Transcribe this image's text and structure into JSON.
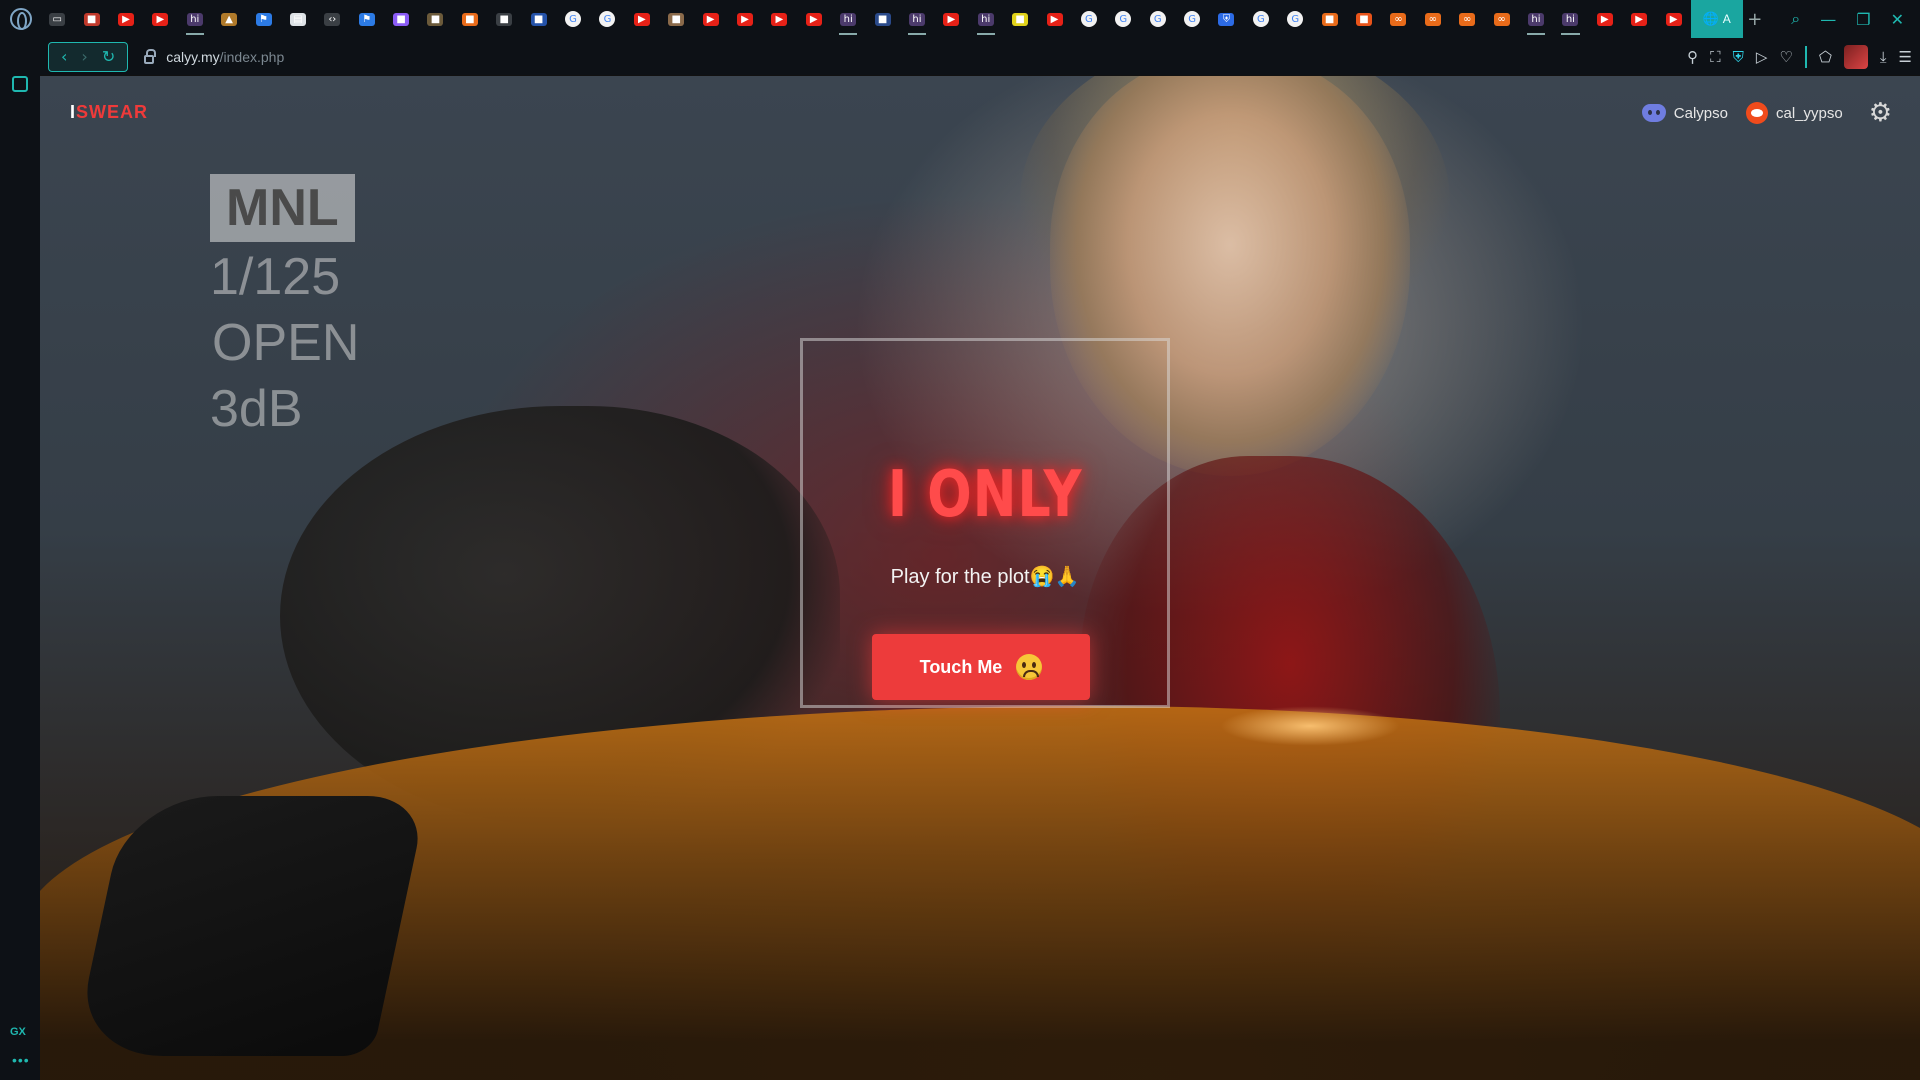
{
  "browser": {
    "tab_favicons": [
      {
        "icon": "video-icon",
        "color": "#3a3f44"
      },
      {
        "icon": "app-icon",
        "color": "#c0392b"
      },
      {
        "icon": "youtube-icon",
        "color": "#e62117"
      },
      {
        "icon": "youtube-icon",
        "color": "#e62117"
      },
      {
        "icon": "hianime-icon",
        "color": "#4b3a6b"
      },
      {
        "icon": "drive-icon",
        "color": "#b07a2a"
      },
      {
        "icon": "flag-icon",
        "color": "#2c7be5"
      },
      {
        "icon": "file-icon",
        "color": "#dde2e6"
      },
      {
        "icon": "code-icon",
        "color": "#3a3f44"
      },
      {
        "icon": "flag-icon",
        "color": "#2c7be5"
      },
      {
        "icon": "app-icon",
        "color": "#8b5cf6"
      },
      {
        "icon": "app-icon",
        "color": "#6b5a3a"
      },
      {
        "icon": "app-icon",
        "color": "#e86b1a"
      },
      {
        "icon": "app-icon",
        "color": "#3a3f44"
      },
      {
        "icon": "app-icon",
        "color": "#2452a8"
      },
      {
        "icon": "google-icon",
        "color": "#f2f2f2"
      },
      {
        "icon": "google-icon",
        "color": "#f2f2f2"
      },
      {
        "icon": "youtube-icon",
        "color": "#e62117"
      },
      {
        "icon": "app-icon",
        "color": "#8a6a4a"
      },
      {
        "icon": "youtube-icon",
        "color": "#e62117"
      },
      {
        "icon": "youtube-icon",
        "color": "#e62117"
      },
      {
        "icon": "youtube-icon",
        "color": "#e62117"
      },
      {
        "icon": "youtube-icon",
        "color": "#e62117"
      },
      {
        "icon": "hianime-icon",
        "color": "#4b3a6b"
      },
      {
        "icon": "app-icon",
        "color": "#2a4a8a"
      },
      {
        "icon": "hianime-icon",
        "color": "#4b3a6b"
      },
      {
        "icon": "youtube-icon",
        "color": "#e62117"
      },
      {
        "icon": "hianime-icon",
        "color": "#4b3a6b"
      },
      {
        "icon": "app-icon",
        "color": "#e0d21a"
      },
      {
        "icon": "youtube-icon",
        "color": "#e62117"
      },
      {
        "icon": "google-icon",
        "color": "#f2f2f2"
      },
      {
        "icon": "google-icon",
        "color": "#f2f2f2"
      },
      {
        "icon": "google-icon",
        "color": "#f2f2f2"
      },
      {
        "icon": "google-icon",
        "color": "#f2f2f2"
      },
      {
        "icon": "shield-icon",
        "color": "#2c6be5"
      },
      {
        "icon": "google-icon",
        "color": "#f2f2f2"
      },
      {
        "icon": "google-icon",
        "color": "#f2f2f2"
      },
      {
        "icon": "app-icon",
        "color": "#e86b1a"
      },
      {
        "icon": "app-icon",
        "color": "#e8541a"
      },
      {
        "icon": "link-icon",
        "color": "#e86b1a"
      },
      {
        "icon": "link-icon",
        "color": "#e86b1a"
      },
      {
        "icon": "link-icon",
        "color": "#e86b1a"
      },
      {
        "icon": "link-icon",
        "color": "#e86b1a"
      },
      {
        "icon": "hianime-icon",
        "color": "#4b3a6b"
      },
      {
        "icon": "hianime-icon",
        "color": "#4b3a6b"
      },
      {
        "icon": "youtube-icon",
        "color": "#e62117"
      },
      {
        "icon": "youtube-icon",
        "color": "#e62117"
      },
      {
        "icon": "youtube-icon",
        "color": "#e62117"
      }
    ],
    "active_tab_glyph": "A",
    "new_tab_glyph": "+",
    "url_host": "calyy.my",
    "url_path": "/index.php",
    "accent_color": "#1fb8b0"
  },
  "site": {
    "logo_prefix": "I",
    "logo_word": "SWEAR",
    "nav": {
      "discord_label": "Calypso",
      "reddit_label": "cal_yypso"
    },
    "exif": {
      "location": "MNL",
      "shutter": "1/125",
      "aperture": "OPEN",
      "gain": "3dB"
    },
    "hero": {
      "headline": "I ONLY",
      "tagline": "Play for the plot😭🙏",
      "button_label": "Touch Me"
    },
    "colors": {
      "brand_red": "#ed3b3b"
    }
  }
}
